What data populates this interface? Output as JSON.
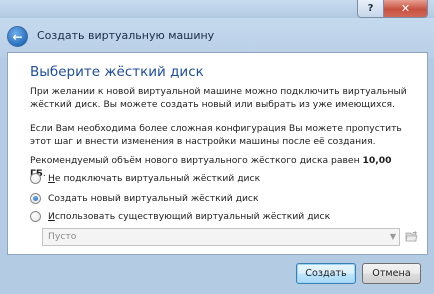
{
  "window": {
    "help_glyph": "?",
    "close_glyph": "✕"
  },
  "header": {
    "title": "Создать виртуальную машину",
    "back_glyph": "←"
  },
  "page": {
    "title": "Выберите жёсткий диск",
    "intro": "При желании к новой виртуальной машине можно подключить виртуальный жёсткий диск. Вы можете создать новый или выбрать из уже имеющихся.",
    "advanced": "Если Вам необходима более сложная конфигурация Вы можете пропустить этот шаг и внести изменения в настройки машины после её создания.",
    "recommended_prefix": "Рекомендуемый объём нового виртуального жёсткого диска равен",
    "recommended_size": "10,00 ГБ",
    "recommended_suffix": "."
  },
  "options": [
    {
      "mnemonic": "Н",
      "rest": "е подключать виртуальный жёсткий диск",
      "checked": false
    },
    {
      "mnemonic": "",
      "rest": "Создать новый виртуальный жёсткий диск",
      "checked": true
    },
    {
      "mnemonic": "И",
      "rest": "спользовать существующий виртуальный жёсткий диск",
      "checked": false
    }
  ],
  "disk_select": {
    "value": "Пусто",
    "enabled": false
  },
  "buttons": {
    "create": "Создать",
    "cancel": "Отмена"
  },
  "icons": {
    "back": "back-arrow-icon",
    "folder": "folder-open-icon",
    "dropdown": "chevron-down-icon"
  }
}
